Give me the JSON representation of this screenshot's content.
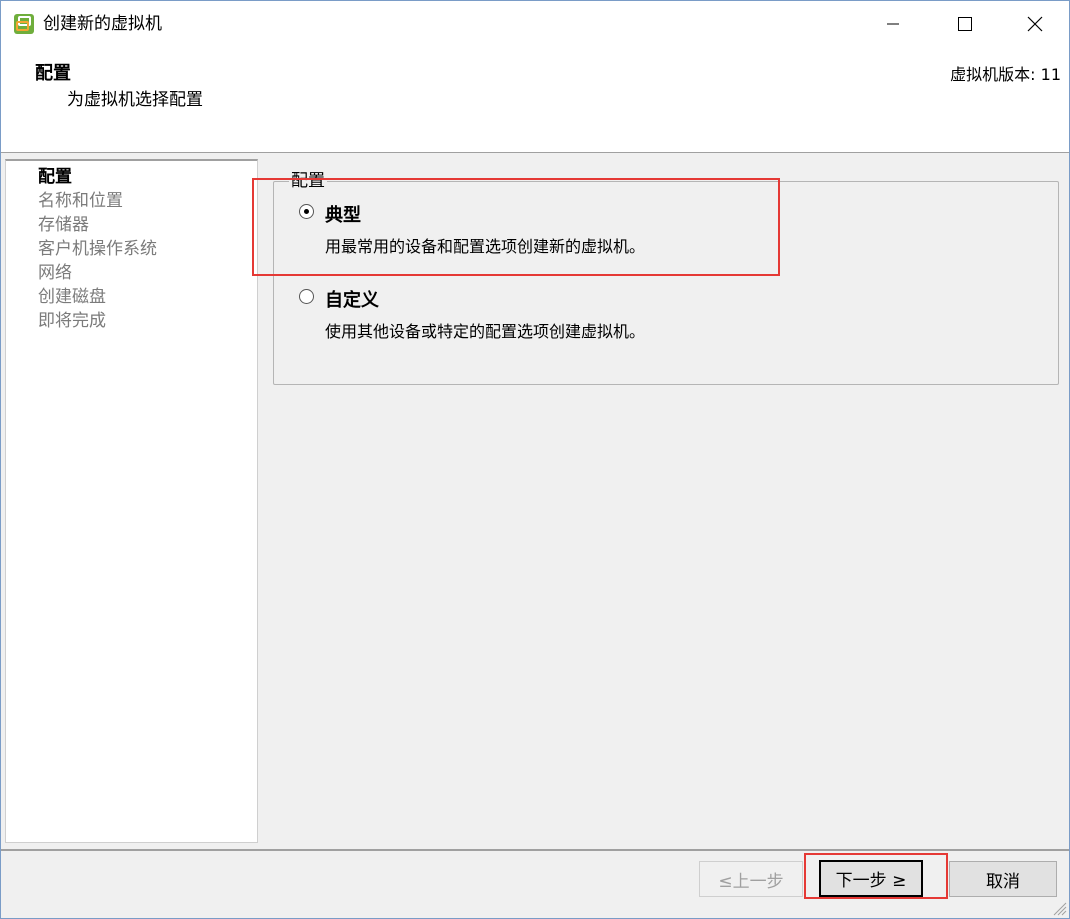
{
  "window": {
    "title": "创建新的虚拟机",
    "icons": {
      "app": "vmware-icon",
      "minimize": "minimize-icon",
      "maximize": "maximize-icon",
      "close": "close-icon"
    }
  },
  "header": {
    "title": "配置",
    "subtitle": "为虚拟机选择配置",
    "version": "虚拟机版本: 11"
  },
  "steps": [
    {
      "label": "配置",
      "active": true
    },
    {
      "label": "名称和位置",
      "active": false
    },
    {
      "label": "存储器",
      "active": false
    },
    {
      "label": "客户机操作系统",
      "active": false
    },
    {
      "label": "网络",
      "active": false
    },
    {
      "label": "创建磁盘",
      "active": false
    },
    {
      "label": "即将完成",
      "active": false
    }
  ],
  "config": {
    "legend": "配置",
    "options": [
      {
        "title": "典型",
        "description": "用最常用的设备和配置选项创建新的虚拟机。",
        "selected": true
      },
      {
        "title": "自定义",
        "description": "使用其他设备或特定的配置选项创建虚拟机。",
        "selected": false
      }
    ]
  },
  "footer": {
    "back_label": "≤上一步",
    "next_label": "下一步 ≥",
    "cancel_label": "取消"
  },
  "colors": {
    "highlight": "#e53935",
    "border": "#7a9cc7"
  }
}
